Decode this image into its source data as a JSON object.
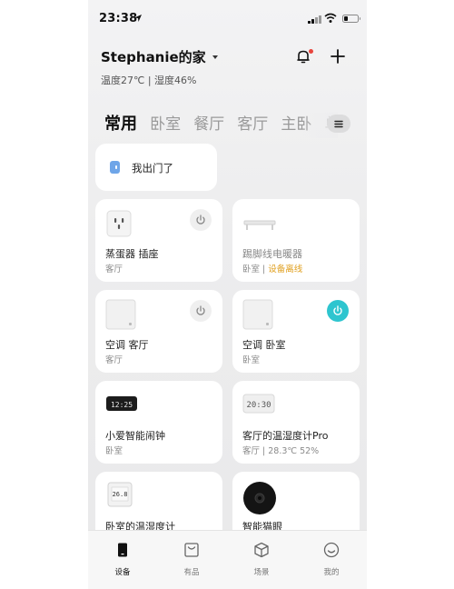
{
  "status_bar": {
    "time": "23:38"
  },
  "home": {
    "title": "Stephanie的家",
    "environment": "温度27℃ | 湿度46%"
  },
  "room_tabs": [
    "常用",
    "卧室",
    "餐厅",
    "客厅",
    "主卧",
    "单"
  ],
  "scene": {
    "label": "我出门了"
  },
  "devices": [
    {
      "name": "蒸蛋器 插座",
      "room": "客厅",
      "status": "",
      "icon": "smart-plug-icon",
      "power": "off"
    },
    {
      "name": "踢脚线电暖器",
      "room": "卧室 | ",
      "status": "设备离线",
      "icon": "baseboard-heater-icon",
      "power": "none"
    },
    {
      "name": "空调 客厅",
      "room": "客厅",
      "status": "",
      "icon": "air-conditioner-controller-icon",
      "power": "off"
    },
    {
      "name": "空调 卧室",
      "room": "卧室",
      "status": "",
      "icon": "air-conditioner-controller-icon",
      "power": "on"
    },
    {
      "name": "小爱智能闹钟",
      "room": "卧室",
      "status": "",
      "icon": "alarm-clock-icon",
      "clock_display": "12:25",
      "power": "none"
    },
    {
      "name": "客厅的温湿度计Pro",
      "room": "客厅 | 28.3℃ 52%",
      "status": "",
      "icon": "thermo-hygrometer-icon",
      "clock_display": "20:30",
      "power": "none"
    },
    {
      "name": "卧室的温湿度计",
      "room": "",
      "status": "",
      "icon": "thermometer-icon",
      "clock_display": "26.8",
      "power": "none"
    },
    {
      "name": "智能猫眼",
      "room": "",
      "status": "",
      "icon": "smart-peephole-icon",
      "power": "none"
    }
  ],
  "tab_bar": [
    {
      "label": "设备",
      "icon": "device-icon",
      "active": true
    },
    {
      "label": "有品",
      "icon": "shopping-bag-icon",
      "active": false
    },
    {
      "label": "场景",
      "icon": "scene-cube-icon",
      "active": false
    },
    {
      "label": "我的",
      "icon": "profile-icon",
      "active": false
    }
  ],
  "colors": {
    "accent_on": "#2ec5cf",
    "offline_warning": "#e0a020",
    "notification_dot": "#e8453c"
  }
}
